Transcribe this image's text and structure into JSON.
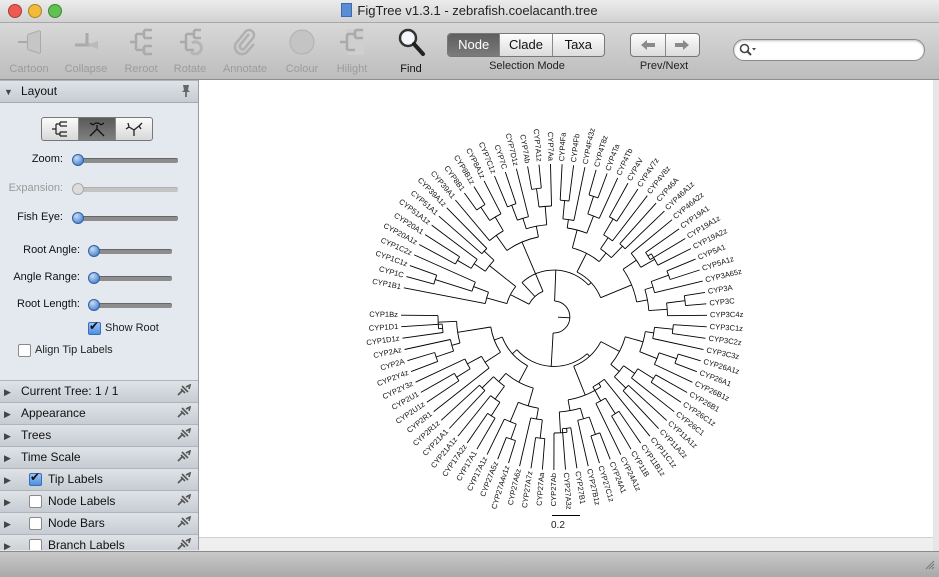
{
  "window": {
    "title": "FigTree v1.3.1 - zebrafish.coelacanth.tree",
    "colors": {
      "close": "#ee5a52",
      "minimize": "#f2bb3a",
      "zoom": "#5fc14f",
      "accent": "#3f7fd6"
    }
  },
  "toolbar": {
    "tools": [
      {
        "label": "Cartoon",
        "icon": "cartoon-icon",
        "enabled": false
      },
      {
        "label": "Collapse",
        "icon": "collapse-icon",
        "enabled": false
      },
      {
        "label": "Reroot",
        "icon": "reroot-icon",
        "enabled": false
      },
      {
        "label": "Rotate",
        "icon": "rotate-icon",
        "enabled": false
      },
      {
        "label": "Annotate",
        "icon": "paperclip-icon",
        "enabled": false
      },
      {
        "label": "Colour",
        "icon": "colour-icon",
        "enabled": false
      },
      {
        "label": "Hilight",
        "icon": "hilight-icon",
        "enabled": false
      },
      {
        "label": "Find",
        "icon": "magnifier-icon",
        "enabled": true
      }
    ],
    "selection_mode": {
      "label": "Selection Mode",
      "options": [
        "Node",
        "Clade",
        "Taxa"
      ],
      "selected": "Node"
    },
    "prev_next": {
      "label": "Prev/Next"
    },
    "search": {
      "placeholder": "",
      "icon": "search-icon"
    }
  },
  "sidebar": {
    "layout": {
      "title": "Layout",
      "layout_types": [
        "rectangular-tree-icon",
        "polar-tree-icon",
        "radial-tree-icon"
      ],
      "selected_layout": "polar-tree-icon",
      "controls": [
        {
          "label": "Zoom:",
          "value": 0.0,
          "enabled": true
        },
        {
          "label": "Expansion:",
          "value": 0.0,
          "enabled": false
        },
        {
          "label": "Fish Eye:",
          "value": 0.0,
          "enabled": true
        },
        {
          "label": "Root Angle:",
          "value": 0.0,
          "enabled": true
        },
        {
          "label": "Angle Range:",
          "value": 0.0,
          "enabled": true
        },
        {
          "label": "Root Length:",
          "value": 0.0,
          "enabled": true
        }
      ],
      "show_root": {
        "label": "Show Root",
        "checked": true
      },
      "align_tip_labels": {
        "label": "Align Tip Labels",
        "checked": false
      }
    },
    "sections": [
      {
        "label": "Current Tree: 1 / 1",
        "checkbox": null
      },
      {
        "label": "Appearance",
        "checkbox": null
      },
      {
        "label": "Trees",
        "checkbox": null
      },
      {
        "label": "Time Scale",
        "checkbox": null
      },
      {
        "label": "Tip Labels",
        "checkbox": true
      },
      {
        "label": "Node Labels",
        "checkbox": false
      },
      {
        "label": "Node Bars",
        "checkbox": false
      },
      {
        "label": "Branch Labels",
        "checkbox": false
      }
    ]
  },
  "tree": {
    "tips": [
      "CYP1B1",
      "CYP1C",
      "CYP1C1z",
      "CYP1C2z",
      "CYP20A1z",
      "CYP20A1",
      "CYP51A1z",
      "CYP51A1",
      "CYP39A1z",
      "CYP39A1",
      "CYP8B1",
      "CYP8B1z",
      "CYP8A1z",
      "CYP7C1z",
      "CYP7C",
      "CYP7D1z",
      "CYP7Ab",
      "CYP7A1z",
      "CYP7Aa",
      "CYP4Fa",
      "CYP4Fb",
      "CYP4F43z",
      "CYP4T8z",
      "CYP4Ta",
      "CYP4Tb",
      "CYP4V",
      "CYP4V7z",
      "CYP4V8z",
      "CYP46A",
      "CYP46A1z",
      "CYP46A2z",
      "CYP19A1",
      "CYP19A1z",
      "CYP19A2z",
      "CYP5A1",
      "CYP5A1z",
      "CYP3A65z",
      "CYP3A",
      "CYP3C",
      "CYP3C4z",
      "CYP3C1z",
      "CYP3C2z",
      "CYP3C3z",
      "CYP26A1z",
      "CYP26A1",
      "CYP26B1z",
      "CYP26B1",
      "CYP26C1z",
      "CYP26C1",
      "CYP11A1z",
      "CYP11A2z",
      "CYP11C1z",
      "CYP11B1z",
      "CYP11B",
      "CYP24A1z",
      "CYP24A1",
      "CYP27C1z",
      "CYP27B1z",
      "CYP27B1",
      "CYP27A3z",
      "CYP27Ab",
      "CYP27Aa",
      "CYP27A7z",
      "CYP27A6z",
      "CYP27A4v1z",
      "CYP27A5z",
      "CYP17A1z",
      "CYP17A1",
      "CYP17A2z",
      "CYP21A1z",
      "CYP21A1",
      "CYP2R1z",
      "CYP2R1",
      "CYP2U1z",
      "CYP2U1",
      "CYP2Y3z",
      "CYP2Y4z",
      "CYP2A",
      "CYP2Az",
      "CYP1D1z",
      "CYP1D1",
      "CYP1Bz"
    ],
    "scale_label": "0.2"
  }
}
